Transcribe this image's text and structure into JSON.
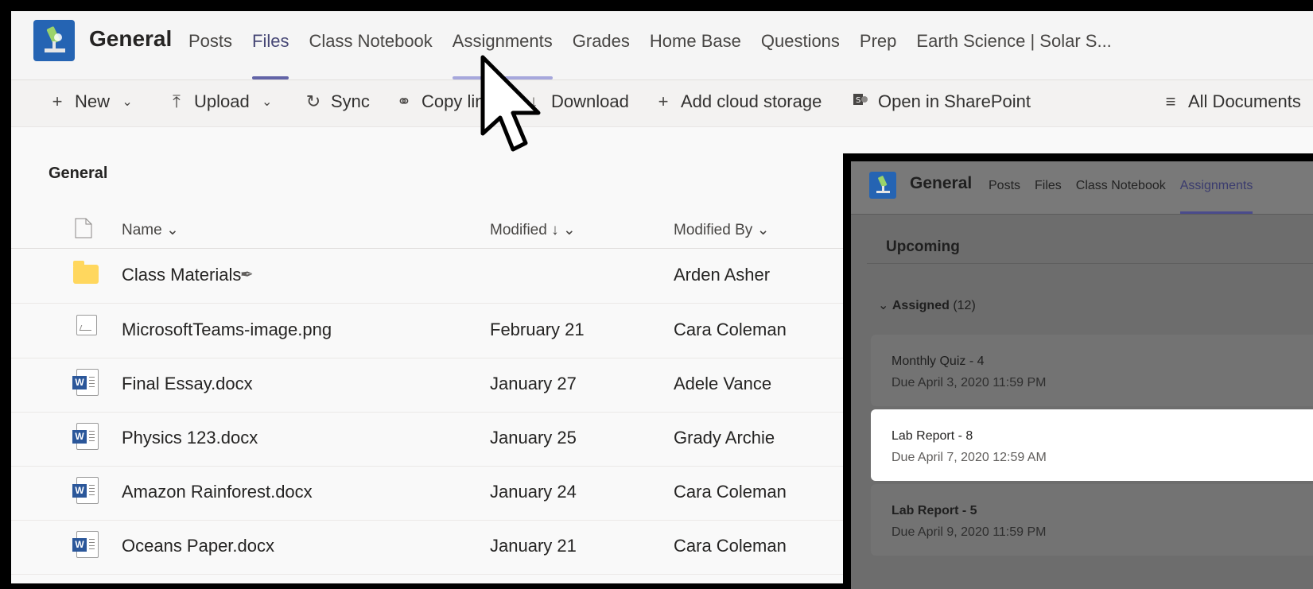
{
  "team": {
    "channel": "General"
  },
  "tabs": [
    {
      "label": "Posts"
    },
    {
      "label": "Files"
    },
    {
      "label": "Class Notebook"
    },
    {
      "label": "Assignments"
    },
    {
      "label": "Grades"
    },
    {
      "label": "Home Base"
    },
    {
      "label": "Questions"
    },
    {
      "label": "Prep"
    },
    {
      "label": "Earth Science | Solar S..."
    }
  ],
  "toolbar": {
    "new": "New",
    "upload": "Upload",
    "sync": "Sync",
    "copy_link": "Copy link",
    "download": "Download",
    "add_cloud": "Add cloud storage",
    "sharepoint": "Open in SharePoint",
    "all_docs": "All Documents"
  },
  "files": {
    "breadcrumb": "General",
    "columns": {
      "name": "Name",
      "modified": "Modified",
      "modified_by": "Modified By"
    },
    "rows": [
      {
        "name": "Class Materials",
        "modified": "",
        "by": "Arden Asher",
        "type": "folder"
      },
      {
        "name": "MicrosoftTeams-image.png",
        "modified": "February 21",
        "by": "Cara Coleman",
        "type": "image"
      },
      {
        "name": "Final Essay.docx",
        "modified": "January 27",
        "by": "Adele Vance",
        "type": "word"
      },
      {
        "name": "Physics 123.docx",
        "modified": "January 25",
        "by": "Grady Archie",
        "type": "word"
      },
      {
        "name": "Amazon Rainforest.docx",
        "modified": "January 24",
        "by": "Cara Coleman",
        "type": "word"
      },
      {
        "name": "Oceans Paper.docx",
        "modified": "January 21",
        "by": "Cara Coleman",
        "type": "word"
      }
    ]
  },
  "overlay": {
    "channel": "General",
    "tabs": [
      "Posts",
      "Files",
      "Class Notebook",
      "Assignments"
    ],
    "section": "Upcoming",
    "group": "Assigned",
    "group_count": "(12)",
    "cards": [
      {
        "title": "Monthly Quiz - 4",
        "due": "Due April 3, 2020 11:59 PM"
      },
      {
        "title": "Lab Report - 8",
        "due": "Due April 7, 2020 12:59 AM"
      },
      {
        "title": "Lab Report - 5",
        "due": "Due April 9, 2020 11:59 PM"
      }
    ]
  },
  "colors": {
    "accent": "#6264a7",
    "team_logo": "#2564b3",
    "folder": "#ffd75e",
    "word": "#2b579a"
  },
  "icons": [
    "microscope-icon",
    "plus-icon",
    "chevron-down-icon",
    "upload-icon",
    "sync-icon",
    "link-icon",
    "download-icon",
    "sharepoint-icon",
    "list-icon",
    "document-icon",
    "folder-icon",
    "image-file-icon",
    "word-file-icon",
    "pointer-cursor-icon"
  ]
}
